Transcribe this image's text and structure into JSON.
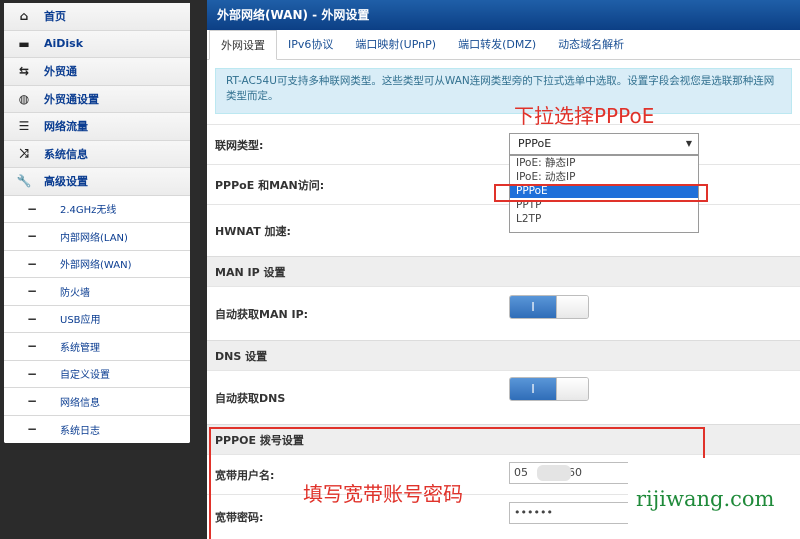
{
  "sidebar": {
    "items": [
      {
        "icon": "home-icon",
        "glyph": "⌂",
        "label": "首页"
      },
      {
        "icon": "printer-icon",
        "glyph": "▬",
        "label": "AiDisk"
      },
      {
        "icon": "network-icon",
        "glyph": "⇆",
        "label": "外贸通"
      },
      {
        "icon": "globe-icon",
        "glyph": "◍",
        "label": "外贸通设置"
      },
      {
        "icon": "list-icon",
        "glyph": "☰",
        "label": "网络流量"
      },
      {
        "icon": "shuffle-icon",
        "glyph": "⤨",
        "label": "系统信息"
      },
      {
        "icon": "wrench-icon",
        "glyph": "🔧",
        "label": "高级设置"
      }
    ],
    "sub_items": [
      "2.4GHz无线",
      "内部网络(LAN)",
      "外部网络(WAN)",
      "防火墙",
      "USB应用",
      "系统管理",
      "自定义设置",
      "网络信息",
      "系统日志"
    ]
  },
  "main": {
    "title": "外部网络(WAN) - 外网设置",
    "tabs": [
      "外网设置",
      "IPv6协议",
      "端口映射(UPnP)",
      "端口转发(DMZ)",
      "动态域名解析"
    ],
    "info_text": "RT-AC54U可支持多种联网类型。这些类型可从WAN连网类型旁的下拉式选单中选取。设置字段会视您是选联那种连网类型而定。",
    "wan_type_label": "联网类型:",
    "wan_type_value": "PPPoE",
    "wan_type_options": [
      "IPoE: 静态IP",
      "IPoE: 动态IP",
      "PPPoE",
      "PPTP",
      "L2TP"
    ],
    "pppoe_man_label": "PPPoE 和MAN访问:",
    "hwnat_label": "HWNAT 加速:",
    "man_ip_section": "MAN IP 设置",
    "man_ip_auto_label": "自动获取MAN IP:",
    "dns_section": "DNS 设置",
    "dns_auto_label": "自动获取DNS",
    "toggle_on_glyph": "I",
    "pppoe_section": "PPPOE 拨号设置",
    "username_label": "宽带用户名:",
    "username_value_a": "05",
    "username_value_b": "60",
    "password_label": "宽带密码:",
    "password_value": "••••••"
  },
  "annotations": {
    "dropdown_note": "下拉选择PPPoE",
    "account_note": "填写宽带账号密码",
    "color": "#e0322a"
  },
  "watermark": "rijiwang.com"
}
